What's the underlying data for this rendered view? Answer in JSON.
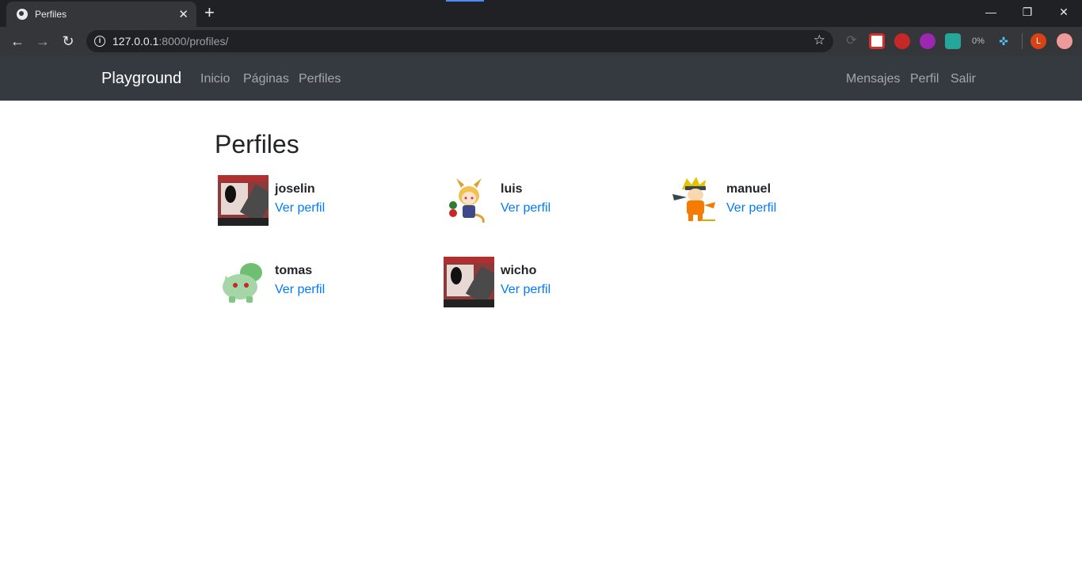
{
  "browser": {
    "tab_title": "Perfiles",
    "url_host": "127.0.0.1",
    "url_rest": ":8000/profiles/",
    "extension_initials": "L"
  },
  "navbar": {
    "brand": "Playground",
    "left_links": [
      "Inicio",
      "Páginas",
      "Perfiles"
    ],
    "right_links": [
      "Mensajes",
      "Perfil",
      "Salir"
    ]
  },
  "page": {
    "title": "Perfiles",
    "link_label": "Ver perfil",
    "profiles": [
      {
        "username": "joselin",
        "avatar": "laptop-screenshot-avatar"
      },
      {
        "username": "luis",
        "avatar": "anime-girl-avatar"
      },
      {
        "username": "manuel",
        "avatar": "ninja-character-avatar"
      },
      {
        "username": "tomas",
        "avatar": "green-creature-avatar"
      },
      {
        "username": "wicho",
        "avatar": "laptop-screenshot-avatar"
      }
    ]
  },
  "colors": {
    "navbar_bg": "#343a40",
    "link": "#007bff",
    "chrome_dark": "#202124",
    "chrome_toolbar": "#35363a"
  }
}
